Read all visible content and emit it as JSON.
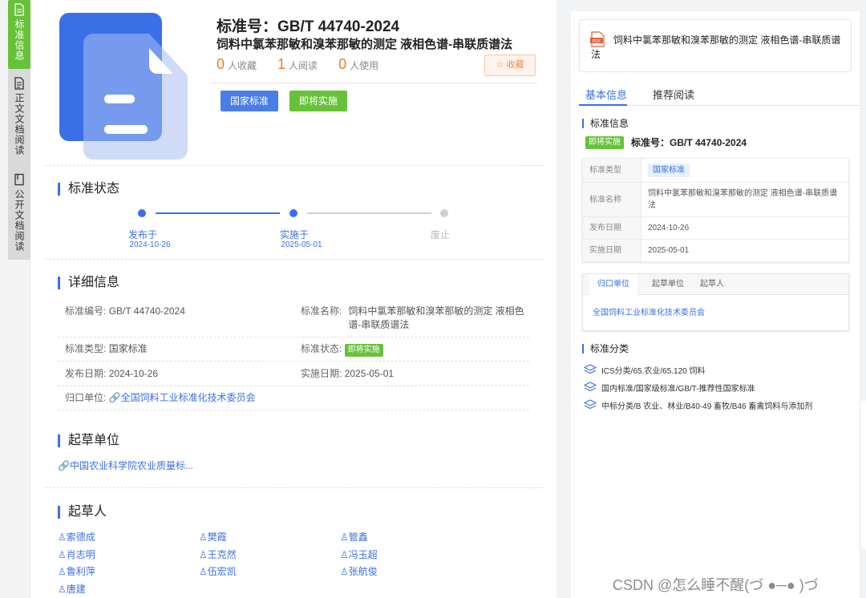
{
  "sidebar": {
    "tabs": [
      {
        "label": "标准信息",
        "icon": "document-info-icon"
      },
      {
        "label": "正文文档阅读",
        "icon": "document-text-icon"
      },
      {
        "label": "公开文档阅读",
        "icon": "book-icon"
      }
    ]
  },
  "header": {
    "std_no": "标准号：GB/T 44740-2024",
    "name": "饲料中氯苯那敏和溴苯那敏的测定 液相色谱-串联质谱法",
    "collect_count": "0",
    "collect_label": "人收藏",
    "read_count": "1",
    "read_label": "人阅读",
    "use_count": "0",
    "use_label": "人使用",
    "collect_button": "☆ 收藏",
    "tag_national": "国家标准",
    "tag_upcoming": "即将实施"
  },
  "status": {
    "title": "标准状态",
    "steps": [
      {
        "label": "发布于",
        "date": "2024-10-26"
      },
      {
        "label": "实施于",
        "date": "2025-05-01"
      },
      {
        "label": "废止",
        "date": ""
      }
    ]
  },
  "details": {
    "title": "详细信息",
    "std_code_k": "标准编号:",
    "std_code_v": "GB/T 44740-2024",
    "std_name_k": "标准名称:",
    "std_name_v": "饲料中氯苯那敏和溴苯那敏的测定 液相色谱-串联质谱法",
    "std_type_k": "标准类型:",
    "std_type_v": "国家标准",
    "std_status_k": "标准状态:",
    "std_status_v": "即将实施",
    "pub_date_k": "发布日期:",
    "pub_date_v": "2024-10-26",
    "impl_date_k": "实施日期:",
    "impl_date_v": "2025-05-01",
    "unit_k": "归口单位:",
    "unit_v": "全国饲料工业标准化技术委员会"
  },
  "drafting_unit": {
    "title": "起草单位",
    "value": "中国农业科学院农业质量标..."
  },
  "drafters": {
    "title": "起草人",
    "names": [
      "索德成",
      "樊霞",
      "管鑫",
      "肖志明",
      "王克然",
      "冯玉超",
      "鲁利萍",
      "伍宏凯",
      "张航俊",
      "唐建"
    ]
  },
  "right": {
    "pdf_badge": "PDF",
    "pdf_title": "饲料中氯苯那敏和溴苯那敏的测定 液相色谱-串联质谱法",
    "tab_basic": "基本信息",
    "tab_recommend": "推荐阅读",
    "info_title": "标准信息",
    "status_tag": "即将实施",
    "std_no": "标准号：GB/T 44740-2024",
    "table": {
      "type_k": "标准类型",
      "type_v": "国家标准",
      "name_k": "标准名称",
      "name_v": "饲料中氯苯那敏和溴苯那敏的测定 液相色谱-串联质谱法",
      "pub_k": "发布日期",
      "pub_v": "2024-10-26",
      "impl_k": "实施日期",
      "impl_v": "2025-05-01"
    },
    "unit_tabs": [
      "归口单位",
      "起草单位",
      "起草人"
    ],
    "unit_value": "全国饲料工业标准化技术委员会",
    "class_title": "标准分类",
    "classes": [
      "ICS分类/65.农业/65.120 饲料",
      "国内标准/国家级标准/GB/T-推荐性国家标准",
      "中标分类/B 农业、林业/B40-49 畜牧/B46 畜禽饲料与添加剂"
    ]
  },
  "watermark": "CSDN @怎么睡不醒(づ ●─● )づ",
  "colors": {
    "accent": "#3a6fe8",
    "green": "#67c23a",
    "orange": "#f07c1b"
  }
}
